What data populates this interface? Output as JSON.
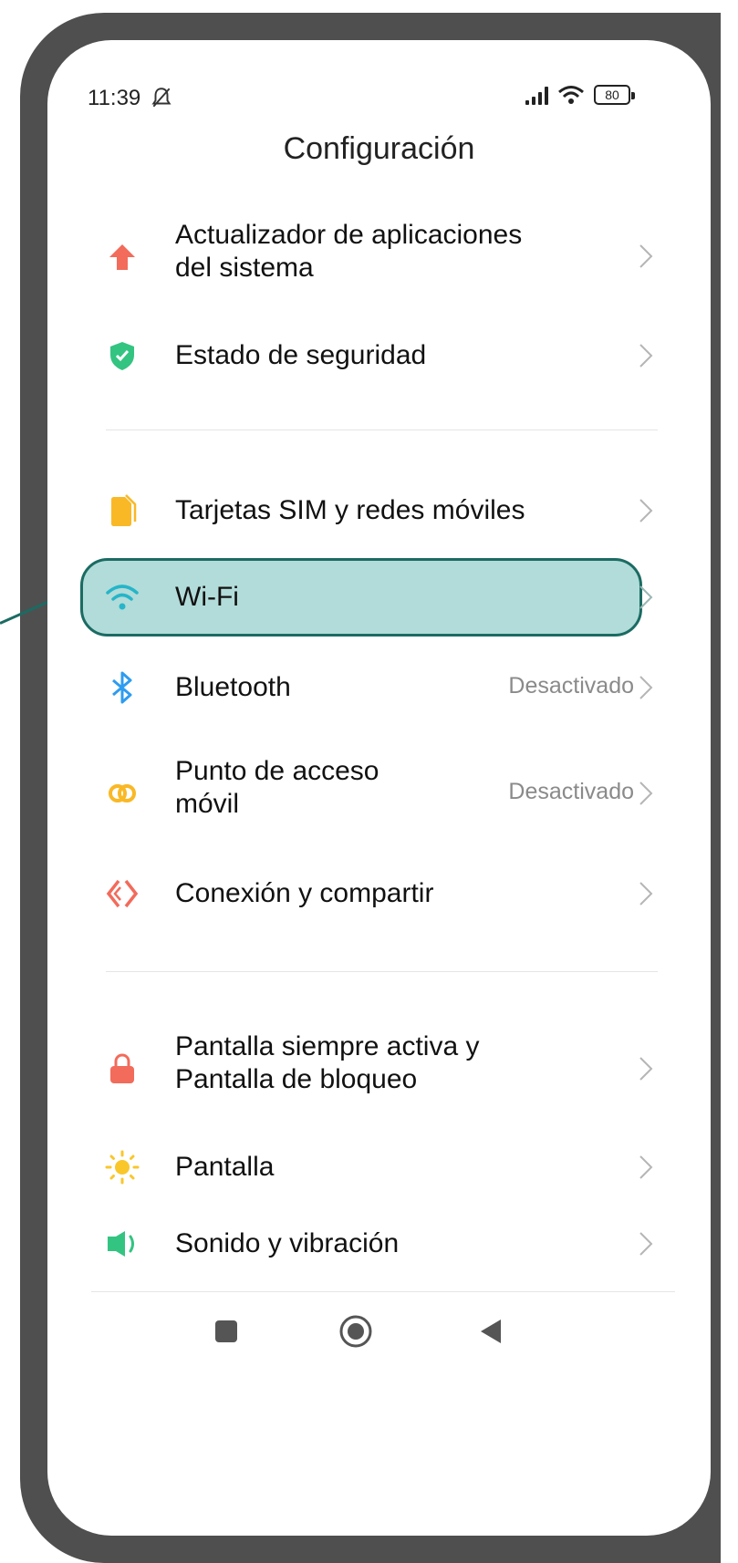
{
  "status_bar": {
    "time": "11:39",
    "battery": "80"
  },
  "header": {
    "title": "Configuración"
  },
  "items": [
    {
      "label_line1": "Actualizador de aplicaciones",
      "label_line2": "del sistema",
      "value": "",
      "icon": "arrow-up-icon",
      "color": "#f26b5b"
    },
    {
      "label": "Estado de seguridad",
      "value": "",
      "icon": "shield-check-icon",
      "color": "#33c481"
    },
    {
      "label": "Tarjetas SIM y redes móviles",
      "value": "",
      "icon": "sim-card-icon",
      "color": "#f9b825"
    },
    {
      "label": "Wi-Fi",
      "value": "",
      "icon": "wifi-icon",
      "color": "#26b5c9"
    },
    {
      "label": "Bluetooth",
      "value": "Desactivado",
      "icon": "bluetooth-icon",
      "color": "#2d9cf0"
    },
    {
      "label_line1": "Punto de acceso",
      "label_line2": "móvil",
      "value": "Desactivado",
      "icon": "hotspot-icon",
      "color": "#f9b825"
    },
    {
      "label": "Conexión y compartir",
      "value": "",
      "icon": "connection-share-icon",
      "color": "#f26b5b"
    },
    {
      "label_line1": "Pantalla siempre activa y",
      "label_line2": "Pantalla de bloqueo",
      "value": "",
      "icon": "lock-icon",
      "color": "#f26b5b"
    },
    {
      "label": "Pantalla",
      "value": "",
      "icon": "sun-icon",
      "color": "#f9c72a"
    },
    {
      "label": "Sonido y vibración",
      "value": "",
      "icon": "speaker-icon",
      "color": "#33c481"
    }
  ],
  "highlight": {
    "item": "Wi-Fi",
    "color": "#b2dcd9",
    "border_color": "#1b6b63"
  },
  "navbar": {
    "buttons": [
      "recents-square-icon",
      "home-circle-icon",
      "back-triangle-icon"
    ]
  }
}
